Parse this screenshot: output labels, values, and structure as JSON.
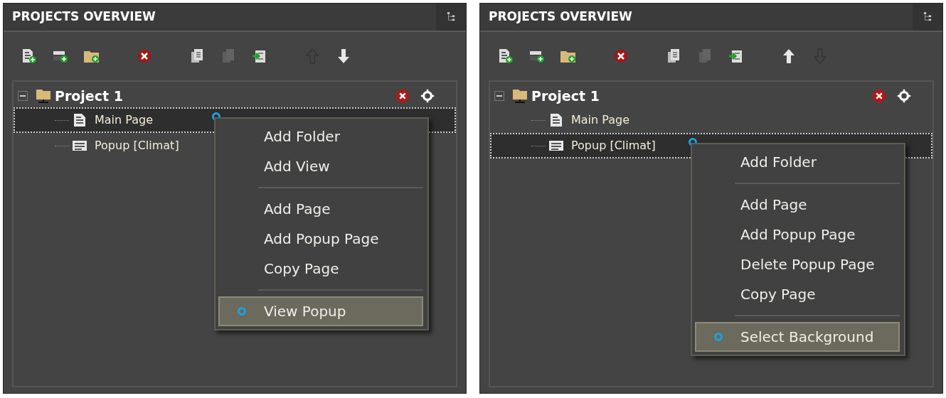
{
  "panels": [
    {
      "title": "PROJECTS OVERVIEW",
      "toolbar": [
        {
          "kind": "add-page",
          "disabled": false
        },
        {
          "kind": "add-popup",
          "disabled": false
        },
        {
          "kind": "add-folder",
          "disabled": false
        },
        {
          "kind": "delete",
          "disabled": false
        },
        {
          "kind": "copy",
          "disabled": false
        },
        {
          "kind": "save",
          "disabled": true
        },
        {
          "kind": "import",
          "disabled": false
        },
        {
          "kind": "up",
          "disabled": true
        },
        {
          "kind": "down",
          "disabled": false
        }
      ],
      "tree": {
        "label": "Project 1",
        "expanded": true,
        "children": [
          {
            "label": "Main Page",
            "kind": "page",
            "selected": true
          },
          {
            "label": "Popup [Climat]",
            "kind": "popup",
            "selected": false
          }
        ]
      },
      "context_menu": [
        {
          "kind": "item",
          "label": "Add Folder",
          "highlighted": false
        },
        {
          "kind": "item",
          "label": "Add View",
          "highlighted": false
        },
        {
          "kind": "separator"
        },
        {
          "kind": "item",
          "label": "Add Page",
          "highlighted": false
        },
        {
          "kind": "item",
          "label": "Add Popup Page",
          "highlighted": false
        },
        {
          "kind": "item",
          "label": "Copy Page",
          "highlighted": false
        },
        {
          "kind": "separator"
        },
        {
          "kind": "item",
          "label": "View Popup",
          "highlighted": true
        }
      ]
    },
    {
      "title": "PROJECTS OVERVIEW",
      "toolbar": [
        {
          "kind": "add-page",
          "disabled": false
        },
        {
          "kind": "add-popup",
          "disabled": false
        },
        {
          "kind": "add-folder",
          "disabled": false
        },
        {
          "kind": "delete",
          "disabled": false
        },
        {
          "kind": "copy",
          "disabled": false
        },
        {
          "kind": "save",
          "disabled": true
        },
        {
          "kind": "import",
          "disabled": false
        },
        {
          "kind": "up",
          "disabled": false
        },
        {
          "kind": "down",
          "disabled": true
        }
      ],
      "tree": {
        "label": "Project 1",
        "expanded": true,
        "children": [
          {
            "label": "Main Page",
            "kind": "page",
            "selected": false
          },
          {
            "label": "Popup [Climat]",
            "kind": "popup",
            "selected": true
          }
        ]
      },
      "context_menu": [
        {
          "kind": "item",
          "label": "Add Folder",
          "highlighted": false
        },
        {
          "kind": "separator"
        },
        {
          "kind": "item",
          "label": "Add Page",
          "highlighted": false
        },
        {
          "kind": "item",
          "label": "Add Popup Page",
          "highlighted": false
        },
        {
          "kind": "item",
          "label": "Delete Popup Page",
          "highlighted": false
        },
        {
          "kind": "item",
          "label": "Copy Page",
          "highlighted": false
        },
        {
          "kind": "separator"
        },
        {
          "kind": "item",
          "label": "Select Background",
          "highlighted": true
        }
      ]
    }
  ]
}
